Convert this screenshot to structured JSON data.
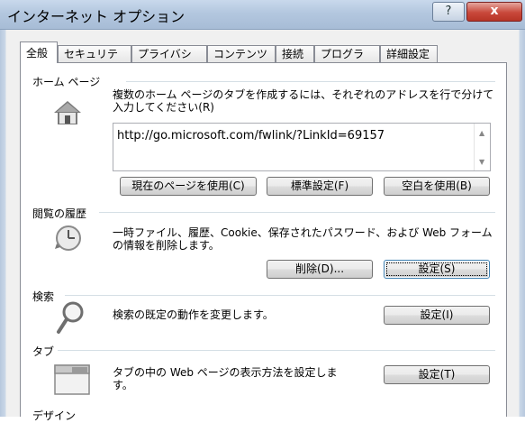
{
  "window": {
    "title": "インターネット オプション",
    "help_glyph": "?",
    "close_glyph": "x"
  },
  "tabs": [
    {
      "label": "全般",
      "active": true
    },
    {
      "label": "セキュリティ"
    },
    {
      "label": "プライバシー"
    },
    {
      "label": "コンテンツ"
    },
    {
      "label": "接続"
    },
    {
      "label": "プログラム"
    },
    {
      "label": "詳細設定"
    }
  ],
  "home": {
    "title": "ホーム ページ",
    "desc_line1": "複数のホーム ページのタブを作成するには、それぞれのアドレスを行で分けて",
    "desc_line2": "入力してください(R)",
    "url": "http://go.microsoft.com/fwlink/?LinkId=69157",
    "btn_current": "現在のページを使用(C)",
    "btn_default": "標準設定(F)",
    "btn_blank": "空白を使用(B)"
  },
  "history": {
    "title": "閲覧の履歴",
    "desc_line1": "一時ファイル、履歴、Cookie、保存されたパスワード、および Web フォーム",
    "desc_line2": "の情報を削除します。",
    "btn_delete": "削除(D)...",
    "btn_settings": "設定(S)"
  },
  "search": {
    "title": "検索",
    "desc": "検索の既定の動作を変更します。",
    "btn_settings": "設定(I)"
  },
  "tabs_section": {
    "title": "タブ",
    "desc_line1": "タブの中の Web ページの表示方法を設定しま",
    "desc_line2": "す。",
    "btn_settings": "設定(T)"
  },
  "design": {
    "title": "デザイン"
  }
}
